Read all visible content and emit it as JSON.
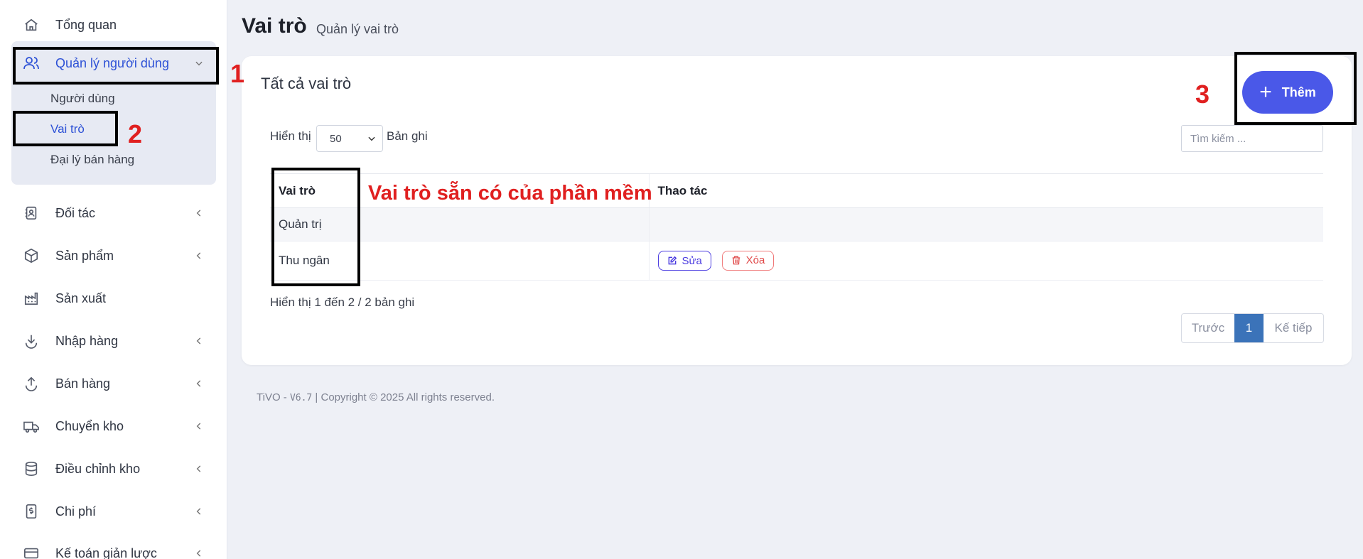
{
  "sidebar": {
    "top_item": "Tổng quan",
    "group": {
      "label": "Quản lý người dùng",
      "children": [
        "Người dùng",
        "Vai trò",
        "Đại lý bán hàng"
      ]
    },
    "items": [
      "Đối tác",
      "Sản phẩm",
      "Sản xuất",
      "Nhập hàng",
      "Bán hàng",
      "Chuyển kho",
      "Điều chỉnh kho",
      "Chi phí",
      "Kế toán giản lược"
    ]
  },
  "header": {
    "title": "Vai trò",
    "subtitle": "Quản lý vai trò"
  },
  "card": {
    "title": "Tất cả vai trò",
    "add_label": "Thêm",
    "length": {
      "before": "Hiển thị",
      "value": "50",
      "after": "Bản ghi"
    },
    "search_placeholder": "Tìm kiếm ...",
    "columns": [
      "Vai trò",
      "Thao tác"
    ],
    "rows": [
      {
        "role": "Quản trị"
      },
      {
        "role": "Thu ngân",
        "edit": "Sửa",
        "delete": "Xóa"
      }
    ],
    "info": "Hiển thị 1 đến 2 / 2 bản ghi",
    "pager": {
      "prev": "Trước",
      "current": "1",
      "next": "Kế tiếp"
    }
  },
  "footer": {
    "brand": "TiVO - ",
    "version": "V6.7",
    "rest": " | Copyright © 2025 All rights reserved."
  },
  "annotations": {
    "n1": "1",
    "n2": "2",
    "n3": "3",
    "note": "Vai trò sẵn có của phần mềm"
  },
  "colors": {
    "accent": "#2d51d6",
    "add_button": "#4a58e8",
    "annotation": "#e02020",
    "pager_active": "#3b73b9"
  }
}
